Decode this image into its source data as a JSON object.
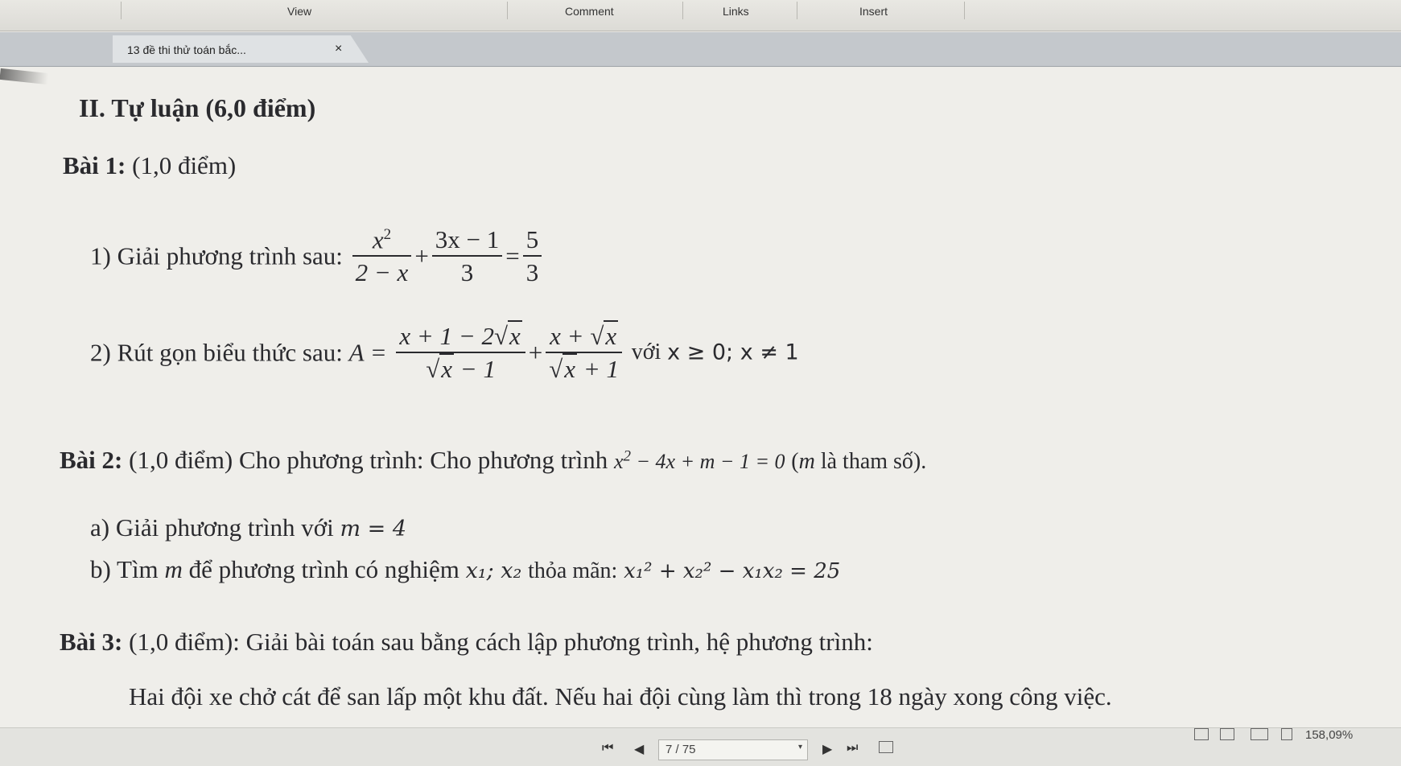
{
  "ribbon": {
    "tabs": [
      "View",
      "Comment",
      "Links",
      "Insert"
    ]
  },
  "tabbar": {
    "doc_title": "13 đề thi thử toán bắc...",
    "close_glyph": "×"
  },
  "content": {
    "section_title": "II. Tự luận (6,0 điểm)",
    "bai1": {
      "heading_bold": "Bài 1:",
      "heading_rest": "(1,0 điểm)",
      "q1_label": "1)  Giải phương trình sau:",
      "q1_eq": {
        "f1_num": "x",
        "f1_num_sup": "2",
        "f1_den": "2 − x",
        "plus": "+",
        "f2_num": "3x − 1",
        "f2_den": "3",
        "eq": "=",
        "f3_num": "5",
        "f3_den": "3"
      },
      "q2_label": "2)  Rút gọn biểu thức sau:",
      "q2_eq": {
        "lhs": "A =",
        "f1_num_pre": "x + 1 − 2",
        "f1_num_rad": "x",
        "f1_den_rad": "x",
        "f1_den_post": " − 1",
        "plus": "+",
        "f2_num_pre": "x + ",
        "f2_num_rad": "x",
        "f2_den_rad": "x",
        "f2_den_post": " + 1",
        "cond_text": "với",
        "cond_math": "x ≥ 0; x ≠ 1"
      }
    },
    "bai2": {
      "heading_bold": "Bài 2:",
      "heading_rest": "(1,0 điểm) Cho phương trình: Cho phương trình",
      "eq_pre": "x",
      "eq_sup": "2",
      "eq_post": " − 4x + m − 1 = 0",
      "note_open": " (",
      "note_m": "m",
      "note_rest": " là tham số).",
      "a_label": "a)  Giải phương trình với",
      "a_math": "m = 4",
      "b_label_pre": "b)  Tìm",
      "b_m": "m",
      "b_label_mid": "để phương trình có nghiệm",
      "b_roots": "x₁; x₂",
      "b_label_post": "thỏa mãn:",
      "b_eq": "x₁² + x₂² − x₁x₂ = 25"
    },
    "bai3": {
      "heading_bold": "Bài 3:",
      "heading_rest": "(1,0 điểm): Giải bài toán sau bằng cách lập phương trình, hệ phương trình:",
      "body": "Hai đội xe chở cát để san lấp một khu đất. Nếu hai đội cùng làm thì trong 18 ngày xong công việc."
    }
  },
  "navbar": {
    "first_glyph": "⏮",
    "prev_glyph": "◀",
    "page_indicator": "7 / 75",
    "dropdown_glyph": "▾",
    "next_glyph": "▶",
    "last_glyph": "⏭",
    "zoom": "158,09%"
  }
}
